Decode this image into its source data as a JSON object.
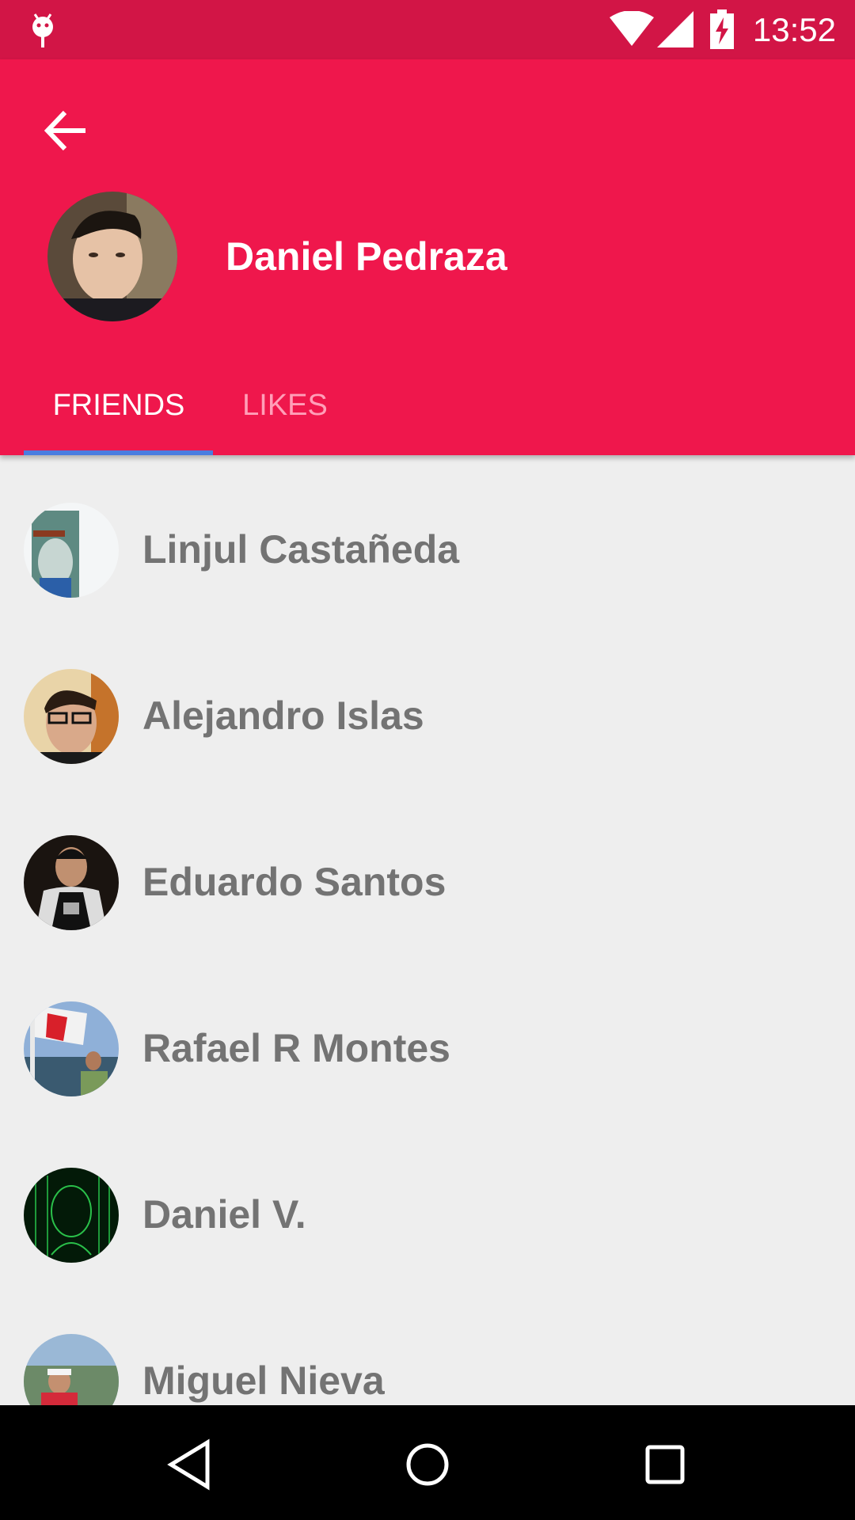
{
  "status_bar": {
    "time": "13:52",
    "icons": [
      "debug-icon",
      "wifi-icon",
      "signal-icon",
      "battery-charging-icon"
    ]
  },
  "header": {
    "back_icon": "arrow-back-icon",
    "profile_name": "Daniel Pedraza",
    "tabs": [
      {
        "label": "FRIENDS",
        "selected": true
      },
      {
        "label": "LIKES",
        "selected": false
      }
    ],
    "colors": {
      "primary": "#ef174c",
      "status": "#d21546",
      "indicator": "#4a7de0"
    }
  },
  "friends": [
    {
      "name": "Linjul Castañeda"
    },
    {
      "name": "Alejandro Islas"
    },
    {
      "name": "Eduardo Santos"
    },
    {
      "name": "Rafael R Montes"
    },
    {
      "name": "Daniel V."
    },
    {
      "name": "Miguel Nieva"
    }
  ],
  "nav_bar": {
    "buttons": [
      "nav-back-icon",
      "nav-home-icon",
      "nav-recents-icon"
    ]
  }
}
